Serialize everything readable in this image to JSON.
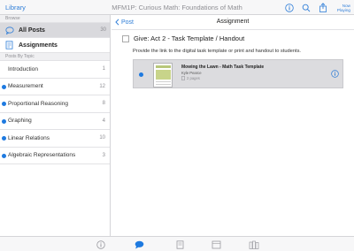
{
  "colors": {
    "accent": "#2f7ed8",
    "topic_dot": "#1e7ae0",
    "selected_bg": "#d9d9dd"
  },
  "topbar": {
    "library_label": "Library",
    "title": "MFM1P: Curious Math: Foundations of Math",
    "icons": [
      "info-icon",
      "search-icon",
      "share-icon"
    ],
    "now_playing_line1": "Now",
    "now_playing_line2": "Playing"
  },
  "sidebar": {
    "browse_header": "Browse",
    "all_posts": {
      "label": "All Posts",
      "count": "30",
      "icon": "speech-bubble-icon"
    },
    "assignments": {
      "label": "Assignments",
      "icon": "assignment-icon"
    },
    "topics_header": "Posts By Topic",
    "topics": [
      {
        "label": "Introduction",
        "count": "1",
        "dot": false
      },
      {
        "label": "Measurement",
        "count": "12",
        "dot": true
      },
      {
        "label": "Proportional Reasoning",
        "count": "8",
        "dot": true
      },
      {
        "label": "Graphing",
        "count": "4",
        "dot": true
      },
      {
        "label": "Linear Relations",
        "count": "10",
        "dot": true
      },
      {
        "label": "Algebraic Representations",
        "count": "3",
        "dot": true
      }
    ]
  },
  "main": {
    "back_label": "Post",
    "title": "Assignment",
    "assignment_title": "Give: Act 2 - Task Template / Handout",
    "instructions": "Provide the link to the digital task template or print and handout to students.",
    "attachment": {
      "title": "Mowing the Lawn - Math Task Template",
      "author": "Kyle Pearce",
      "pages": "2 pages"
    }
  },
  "tabbar": {
    "tabs": [
      "info-tab-icon",
      "posts-tab-icon",
      "notes-tab-icon",
      "materials-tab-icon",
      "books-tab-icon"
    ],
    "active_index": 1
  }
}
